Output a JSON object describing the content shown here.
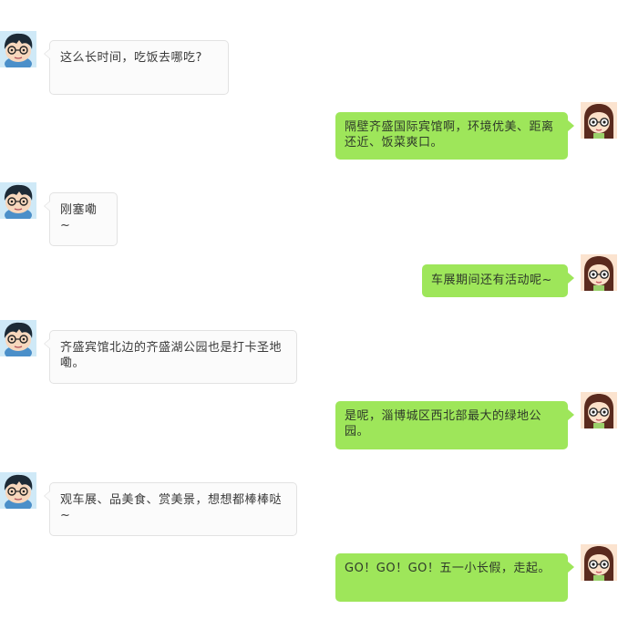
{
  "colors": {
    "incoming_bubble": "#fbfbfb",
    "incoming_border": "#e2e2e2",
    "outgoing_bubble": "#9ee65a",
    "background": "#ffffff"
  },
  "icons": {
    "left_avatar": "boy-with-glasses-avatar-icon",
    "right_avatar": "girl-with-glasses-avatar-icon"
  },
  "messages": [
    {
      "side": "left",
      "text": "这么长时间，吃饭去哪吃?"
    },
    {
      "side": "right",
      "text": "隔壁齐盛国际宾馆啊，环境优美、距离还近、饭菜爽口。"
    },
    {
      "side": "left",
      "text": "刚塞嘞~"
    },
    {
      "side": "right",
      "text": "车展期间还有活动呢~"
    },
    {
      "side": "left",
      "text": "齐盛宾馆北边的齐盛湖公园也是打卡圣地嘞。"
    },
    {
      "side": "right",
      "text": "是呢，淄博城区西北部最大的绿地公园。"
    },
    {
      "side": "left",
      "text": "观车展、品美食、赏美景，想想都棒棒哒~"
    },
    {
      "side": "right",
      "text": "GO！GO！GO！五一小长假，走起。"
    }
  ]
}
